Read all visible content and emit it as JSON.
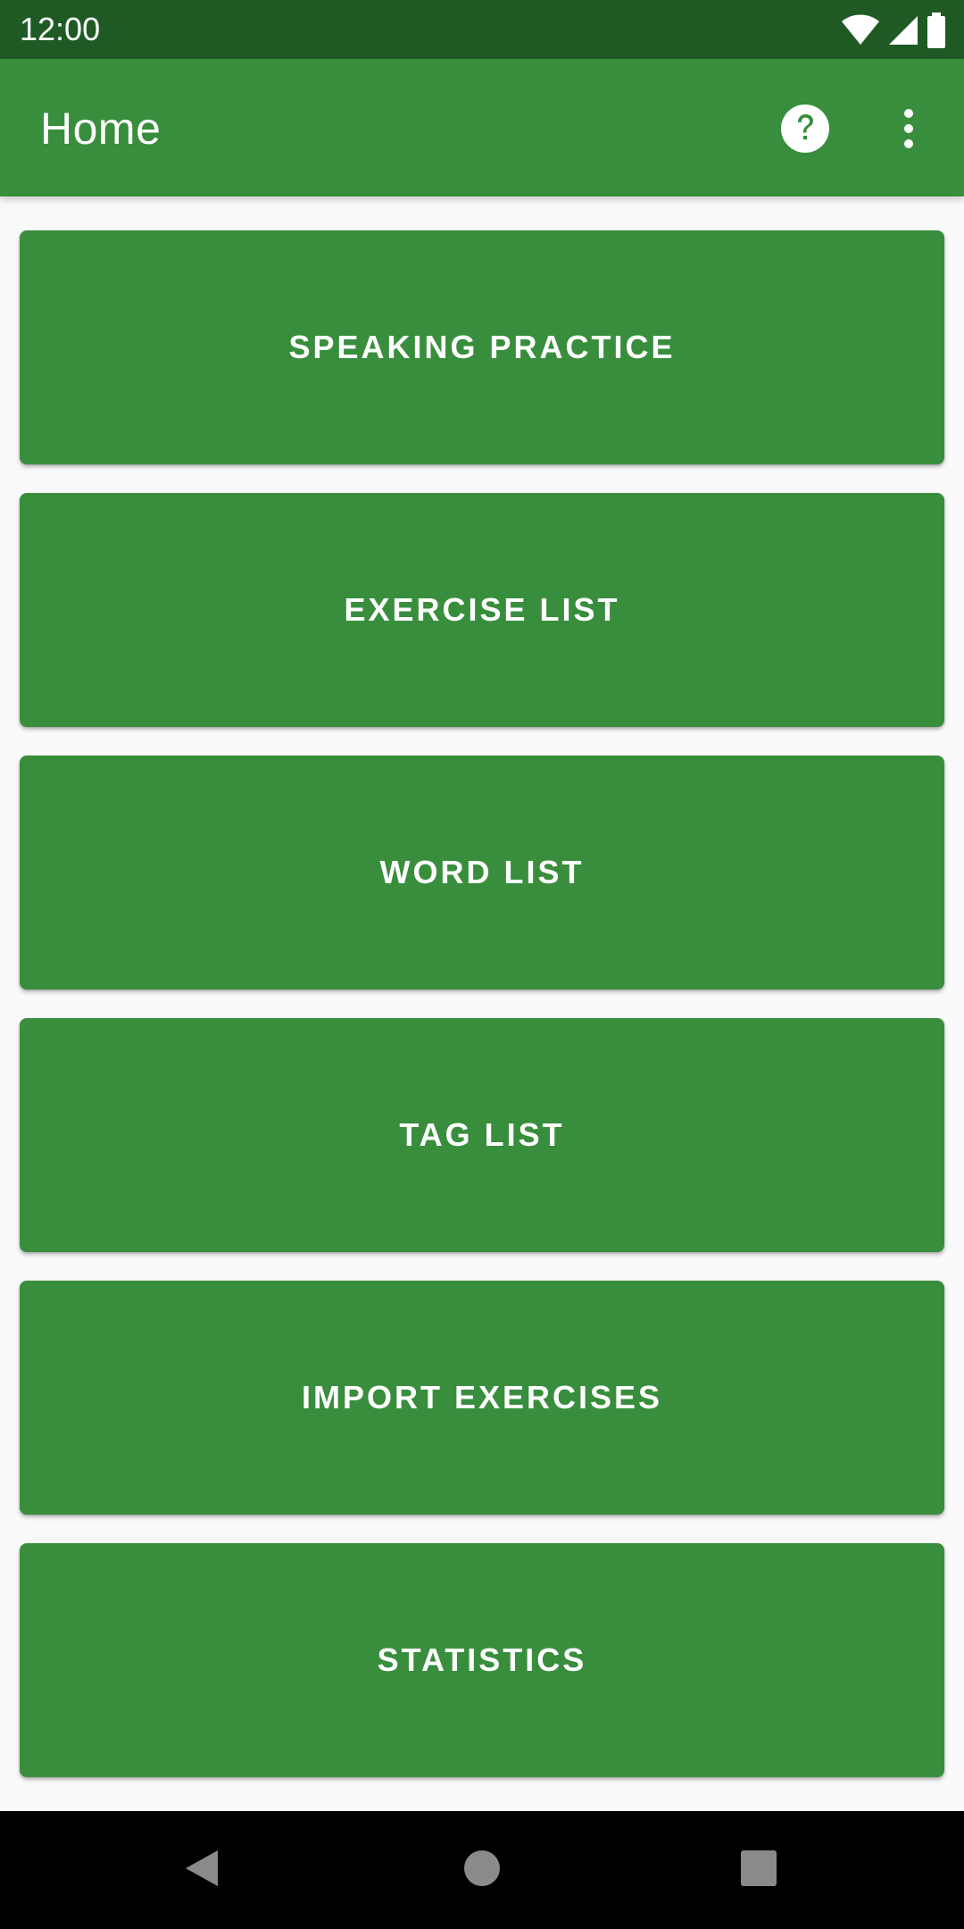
{
  "status_bar": {
    "time": "12:00",
    "icons": [
      "wifi-icon",
      "cellular-signal-icon",
      "battery-icon"
    ]
  },
  "app_bar": {
    "title": "Home",
    "actions": [
      "help-icon",
      "more-vert-icon"
    ]
  },
  "menu": {
    "items": [
      {
        "label": "SPEAKING PRACTICE"
      },
      {
        "label": "EXERCISE LIST"
      },
      {
        "label": "WORD LIST"
      },
      {
        "label": "TAG LIST"
      },
      {
        "label": "IMPORT EXERCISES"
      },
      {
        "label": "STATISTICS"
      }
    ]
  },
  "nav_bar": {
    "buttons": [
      "back-icon",
      "home-icon",
      "recents-icon"
    ]
  },
  "colors": {
    "primary": "#388e3c",
    "primary_dark": "#1f5a24",
    "background": "#fafafa",
    "on_primary": "#ffffff"
  }
}
